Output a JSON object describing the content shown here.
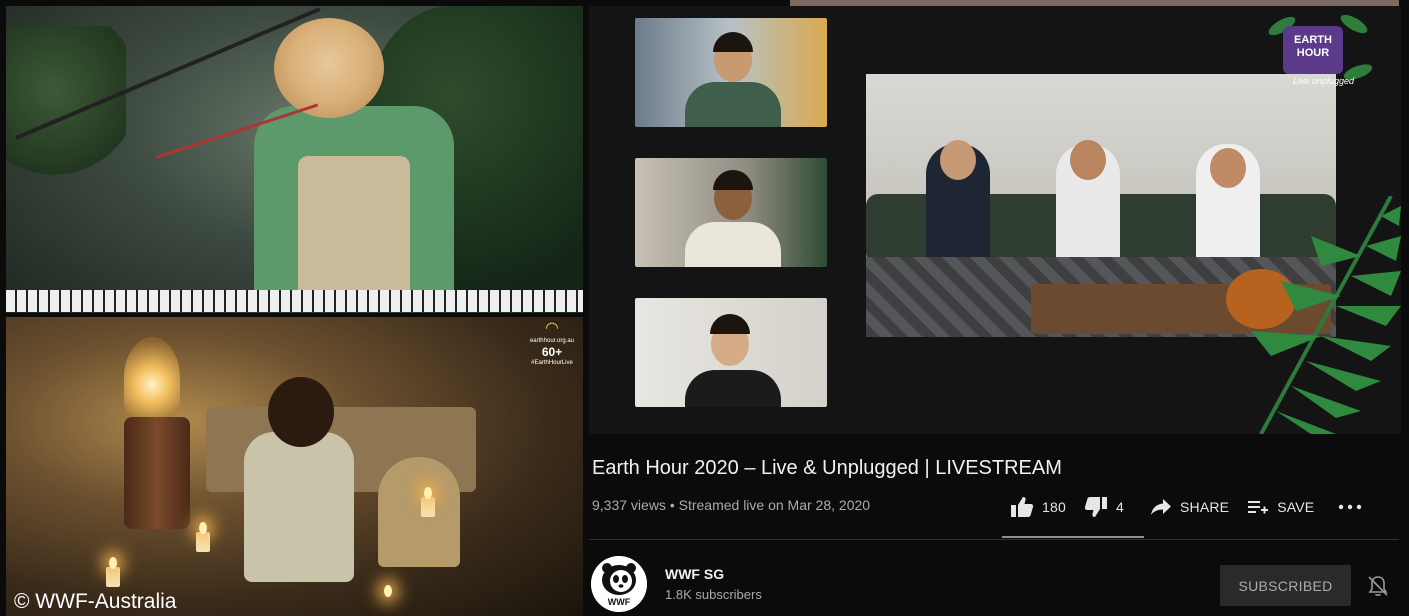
{
  "left_panels": {
    "watermark_logo": {
      "small_text": "earthhour.org.au",
      "big_text": "60+",
      "hashtag": "#EarthHourLive"
    },
    "copyright": "© WWF-Australia"
  },
  "player": {
    "badge_text": "EARTH HOUR",
    "badge_subtext": "Live unplugged"
  },
  "video": {
    "title": "Earth Hour 2020 – Live & Unplugged | LIVESTREAM",
    "meta": "9,337 views • Streamed live on Mar 28, 2020",
    "likes": "180",
    "dislikes": "4",
    "share_label": "SHARE",
    "save_label": "SAVE"
  },
  "channel": {
    "name": "WWF SG",
    "subscribers": "1.8K subscribers",
    "subscribe_label": "SUBSCRIBED",
    "avatar_text": "WWF"
  },
  "colors": {
    "background": "#0b0b0b",
    "text_primary": "#f1f1f1",
    "text_secondary": "#aaaaaa",
    "subscribed_button": "#2a2a2a"
  }
}
